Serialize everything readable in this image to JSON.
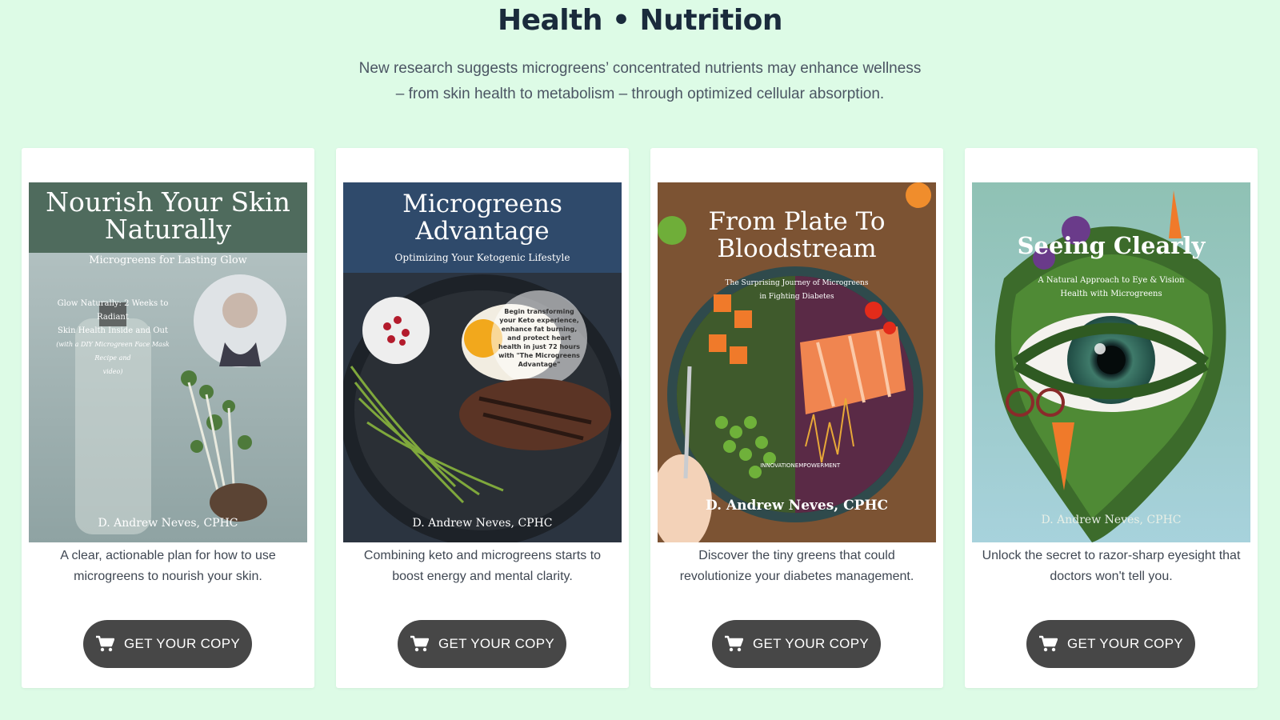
{
  "section": {
    "title": "Health • Nutrition",
    "subtitle_line1": "New research suggests microgreens’ concentrated nutrients may enhance wellness",
    "subtitle_line2": "– from skin health to metabolism – through optimized cellular absorption."
  },
  "cards": [
    {
      "cover_title_line1": "Nourish Your Skin",
      "cover_title_line2": "Naturally",
      "cover_subtitle": "Microgreens for Lasting Glow",
      "cover_blurb_line1": "Glow Naturally: 2 Weeks to Radiant",
      "cover_blurb_line2": "Skin Health Inside and Out",
      "cover_blurb_line3": "(with a DIY Microgreen Face Mask Recipe and",
      "cover_blurb_line4": "video)",
      "author": "D. Andrew Neves, CPHC",
      "description": "A clear, actionable plan for how to use microgreens to nourish your skin.",
      "cta_label": "GET YOUR COPY"
    },
    {
      "cover_title_line1": "Microgreens",
      "cover_title_line2": "Advantage",
      "cover_subtitle": "Optimizing Your Ketogenic Lifestyle",
      "cover_blurb": "Begin transforming your Keto experience, enhance fat burning, and protect heart health in just 72 hours with \"The Microgreens Advantage\"",
      "author": "D. Andrew Neves, CPHC",
      "description": "Combining keto and microgreens starts to boost energy and mental clarity.",
      "cta_label": "GET YOUR COPY"
    },
    {
      "cover_title_line1": "From Plate To",
      "cover_title_line2": "Bloodstream",
      "cover_subtitle_line1": "The Surprising Journey of Microgreens",
      "cover_subtitle_line2": "in Fighting Diabetes",
      "cover_label_left": "INNOVATION",
      "cover_label_right": "EMPOWERMENT",
      "author": "D. Andrew Neves, CPHC",
      "description": "Discover the tiny greens that could revolutionize your diabetes management.",
      "cta_label": "GET YOUR COPY"
    },
    {
      "cover_title": "Seeing Clearly",
      "cover_subtitle_line1": "A Natural Approach to Eye & Vision",
      "cover_subtitle_line2": "Health with Microgreens",
      "author": "D. Andrew Neves, CPHC",
      "description": "Unlock the secret to razor-sharp eyesight that doctors won't tell you.",
      "cta_label": "GET YOUR COPY"
    }
  ],
  "icons": {
    "cta": "shopping-cart-icon"
  },
  "colors": {
    "page_bg": "#ddfbe6",
    "card_bg": "#ffffff",
    "cta_bg": "#474747",
    "title": "#1a2b3c"
  }
}
